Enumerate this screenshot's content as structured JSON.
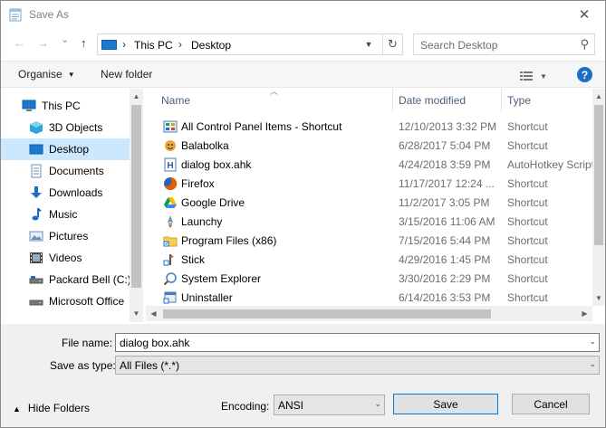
{
  "window": {
    "title": "Save As",
    "close_glyph": "✕"
  },
  "nav": {
    "back_glyph": "←",
    "forward_glyph": "→",
    "recent_glyph": "⌄",
    "up_glyph": "↑",
    "address": {
      "crumbs": [
        "This PC",
        "Desktop"
      ],
      "separator": "›"
    },
    "search_placeholder": "Search Desktop"
  },
  "toolbar": {
    "organise_label": "Organise",
    "new_folder_label": "New folder",
    "help_label": "?"
  },
  "sidebar": {
    "items": [
      {
        "label": "This PC",
        "icon": "computer-icon",
        "color": "#1979ca"
      },
      {
        "label": "3D Objects",
        "icon": "cube-icon",
        "color": "#2aa6d8"
      },
      {
        "label": "Desktop",
        "icon": "desktop-icon",
        "color": "#1979ca",
        "selected": true
      },
      {
        "label": "Documents",
        "icon": "document-icon",
        "color": "#6b8fb5"
      },
      {
        "label": "Downloads",
        "icon": "download-icon",
        "color": "#1d6fc6"
      },
      {
        "label": "Music",
        "icon": "music-icon",
        "color": "#1d6fc6"
      },
      {
        "label": "Pictures",
        "icon": "pictures-icon",
        "color": "#6b8fb5"
      },
      {
        "label": "Videos",
        "icon": "video-icon",
        "color": "#444444"
      },
      {
        "label": "Packard Bell (C:)",
        "icon": "drive-icon",
        "color": "#555555"
      },
      {
        "label": "Microsoft Office",
        "icon": "drive-icon",
        "color": "#555555"
      }
    ]
  },
  "filelist": {
    "columns": {
      "name": "Name",
      "date": "Date modified",
      "type": "Type"
    },
    "rows": [
      {
        "name": "All Control Panel Items - Shortcut",
        "date": "12/10/2013 3:32 PM",
        "type": "Shortcut",
        "icon": "control-panel-icon"
      },
      {
        "name": "Balabolka",
        "date": "6/28/2017 5:04 PM",
        "type": "Shortcut",
        "icon": "balabolka-icon"
      },
      {
        "name": "dialog box.ahk",
        "date": "4/24/2018 3:59 PM",
        "type": "AutoHotkey Script",
        "icon": "ahk-file-icon"
      },
      {
        "name": "Firefox",
        "date": "11/17/2017 12:24 ...",
        "type": "Shortcut",
        "icon": "firefox-icon"
      },
      {
        "name": "Google Drive",
        "date": "11/2/2017 3:05 PM",
        "type": "Shortcut",
        "icon": "google-drive-icon"
      },
      {
        "name": "Launchy",
        "date": "3/15/2016 11:06 AM",
        "type": "Shortcut",
        "icon": "launchy-icon"
      },
      {
        "name": "Program Files (x86)",
        "date": "7/15/2016 5:44 PM",
        "type": "Shortcut",
        "icon": "folder-shortcut-icon"
      },
      {
        "name": "Stick",
        "date": "4/29/2016 1:45 PM",
        "type": "Shortcut",
        "icon": "stick-icon"
      },
      {
        "name": "System Explorer",
        "date": "3/30/2016 2:29 PM",
        "type": "Shortcut",
        "icon": "system-explorer-icon"
      },
      {
        "name": "Uninstaller",
        "date": "6/14/2016 3:53 PM",
        "type": "Shortcut",
        "icon": "uninstaller-icon"
      }
    ]
  },
  "form": {
    "file_name_label": "File name:",
    "file_name_value": "dialog box.ahk",
    "save_type_label": "Save as type:",
    "save_type_value": "All Files  (*.*)",
    "hide_folders_label": "Hide Folders",
    "encoding_label": "Encoding:",
    "encoding_value": "ANSI",
    "save_label": "Save",
    "cancel_label": "Cancel"
  },
  "colors": {
    "accent": "#0078d7",
    "selection": "#cce8ff",
    "header_text": "#4c607a"
  }
}
